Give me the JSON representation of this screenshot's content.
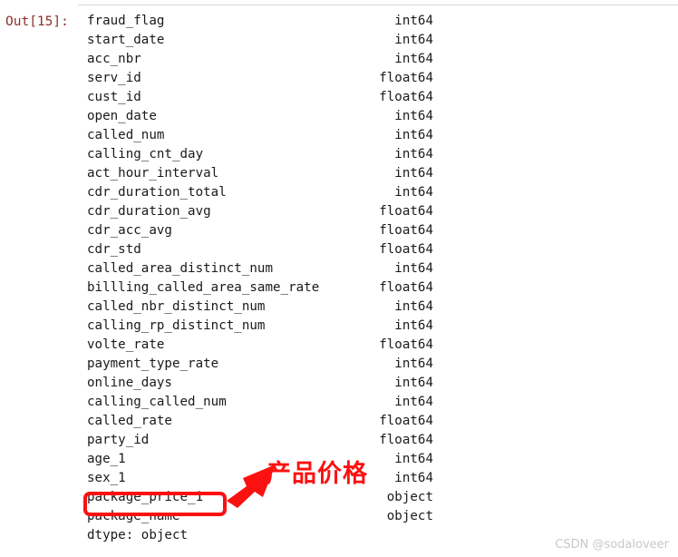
{
  "output_cell": {
    "prompt_label": "Out[15]:",
    "prompt_color": "#8b2f28",
    "footer_line": "dtype: object",
    "rows": [
      {
        "name": "fraud_flag",
        "dtype": "int64"
      },
      {
        "name": "start_date",
        "dtype": "int64"
      },
      {
        "name": "acc_nbr",
        "dtype": "int64"
      },
      {
        "name": "serv_id",
        "dtype": "float64"
      },
      {
        "name": "cust_id",
        "dtype": "float64"
      },
      {
        "name": "open_date",
        "dtype": "int64"
      },
      {
        "name": "called_num",
        "dtype": "int64"
      },
      {
        "name": "calling_cnt_day",
        "dtype": "int64"
      },
      {
        "name": "act_hour_interval",
        "dtype": "int64"
      },
      {
        "name": "cdr_duration_total",
        "dtype": "int64"
      },
      {
        "name": "cdr_duration_avg",
        "dtype": "float64"
      },
      {
        "name": "cdr_acc_avg",
        "dtype": "float64"
      },
      {
        "name": "cdr_std",
        "dtype": "float64"
      },
      {
        "name": "called_area_distinct_num",
        "dtype": "int64"
      },
      {
        "name": "billling_called_area_same_rate",
        "dtype": "float64"
      },
      {
        "name": "called_nbr_distinct_num",
        "dtype": "int64"
      },
      {
        "name": "calling_rp_distinct_num",
        "dtype": "int64"
      },
      {
        "name": "volte_rate",
        "dtype": "float64"
      },
      {
        "name": "payment_type_rate",
        "dtype": "int64"
      },
      {
        "name": "online_days",
        "dtype": "int64"
      },
      {
        "name": "calling_called_num",
        "dtype": "int64"
      },
      {
        "name": "called_rate",
        "dtype": "float64"
      },
      {
        "name": "party_id",
        "dtype": "float64"
      },
      {
        "name": "age_1",
        "dtype": "int64"
      },
      {
        "name": "sex_1",
        "dtype": "int64"
      },
      {
        "name": "package_price_1",
        "dtype": "object"
      },
      {
        "name": "package_name",
        "dtype": "object"
      }
    ]
  },
  "annotation": {
    "color": "#fc1111",
    "text": "产品价格",
    "highlighted_row": "package_price_1",
    "arrow_icon": "arrow-left-down-icon"
  },
  "watermark": {
    "text": "CSDN @sodaloveer"
  }
}
